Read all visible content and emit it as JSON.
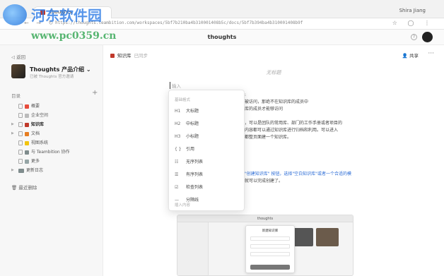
{
  "browser": {
    "tab_title": "thoughts",
    "user": "Shira Jiang",
    "url": "https://thoughts.teambition.com/workspaces/5bf7b210ba4b310001408b5c/docs/5bf7b394ba4b310001408b9f",
    "nav_icons": "← → ↻",
    "addr_icons": "☆ ◯ ⋮"
  },
  "app": {
    "title": "thoughts",
    "help": "?"
  },
  "watermark": {
    "title": "河东软件园",
    "url": "www.pc0359.cn"
  },
  "sidebar": {
    "back": "返回",
    "space_name": "Thoughts 产品介绍 ⌄",
    "space_sub": "已被 Thoughts 官方邀请",
    "dir_label": "目录",
    "add": "+",
    "items": [
      {
        "label": "概要",
        "color": "#e74c3c"
      },
      {
        "label": "企业空间",
        "color": "#bbbbbb"
      },
      {
        "label": "知识库",
        "color": "#c0392b",
        "active": true
      },
      {
        "label": "文档",
        "color": "#e67e22"
      },
      {
        "label": "视图系统",
        "color": "#f1c40f"
      },
      {
        "label": "与 Teambition 协作",
        "color": "#7f8c8d"
      },
      {
        "label": "更多",
        "color": "#95a5a6"
      },
      {
        "label": "更新日志",
        "color": "#7f8c8d"
      }
    ],
    "trash": "最近删除"
  },
  "doc": {
    "crumb_title": "知识库",
    "saved": "已同步",
    "share": "共享",
    "more": "···",
    "title_placeholder": "无标题",
    "input_placeholder": "输入",
    "lines": [
      {
        "text": ":",
        "link": false
      },
      {
        "text": "被访问，那绝不在知识库的成员中",
        "link": false
      },
      {
        "text": "库的成员才能够访问",
        "link": false
      },
      {
        "text": "",
        "link": false
      },
      {
        "text": "，可以是团队的常用库、部门的工作手册或者项目的",
        "link": false
      },
      {
        "text": "内容都可以通过知识库进行归档和利用。可以进入",
        "link": false
      },
      {
        "text": "都整页面建一个知识库。",
        "link": false
      }
    ],
    "lines2": [
      {
        "text": "\"创建知识库\" 按钮，选择\"空白知识库\"或者一个合适的模",
        "link": true
      },
      {
        "text": "就可以完成创建了。",
        "link": false
      }
    ],
    "thumb_title": "thoughts",
    "thumb_modal_title": "新建知识库"
  },
  "popup": {
    "header": "基础格式",
    "items": [
      {
        "icon": "H1",
        "label": "大标题"
      },
      {
        "icon": "H2",
        "label": "中标题"
      },
      {
        "icon": "H3",
        "label": "小标题"
      },
      {
        "icon": "{ }",
        "label": "引用"
      },
      {
        "icon": "☷",
        "label": "无序列表"
      },
      {
        "icon": "☰",
        "label": "有序列表"
      },
      {
        "icon": "☑",
        "label": "检查列表"
      },
      {
        "icon": "—",
        "label": "分隔线"
      }
    ],
    "footer": "插入内容"
  }
}
